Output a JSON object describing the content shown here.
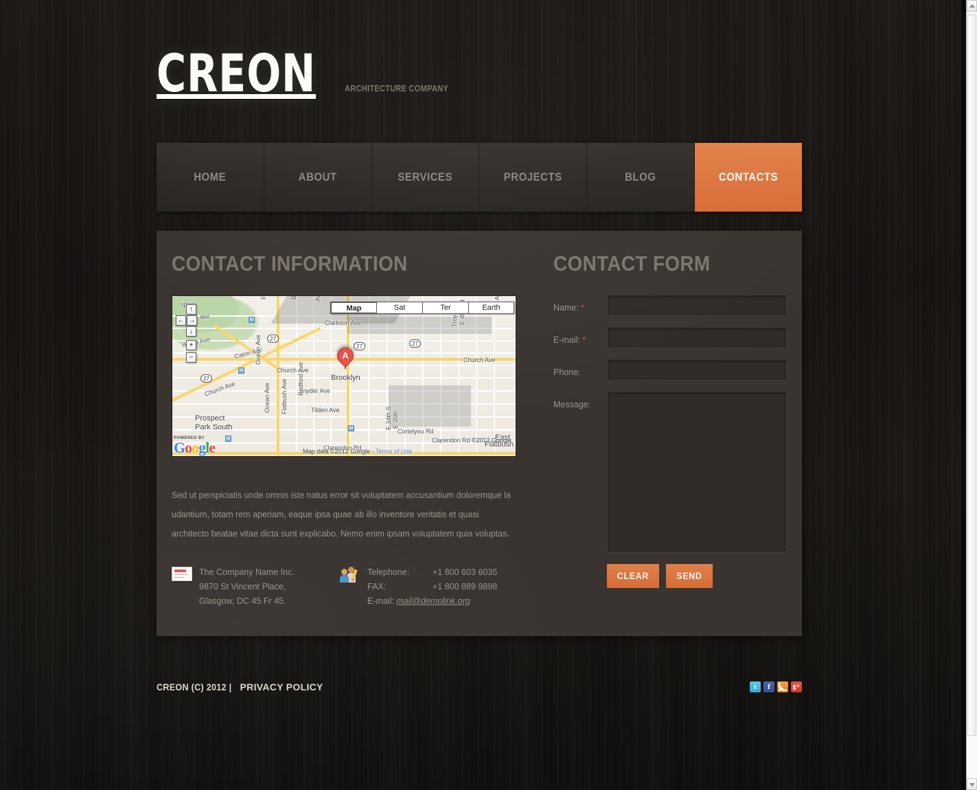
{
  "site": {
    "logo_name": "CREON",
    "logo_tagline": "Architecture Company"
  },
  "nav": {
    "items": [
      {
        "label": "Home",
        "active": false
      },
      {
        "label": "About",
        "active": false
      },
      {
        "label": "Services",
        "active": false
      },
      {
        "label": "Projects",
        "active": false
      },
      {
        "label": "Blog",
        "active": false
      },
      {
        "label": "Contacts",
        "active": true
      }
    ]
  },
  "contact_information": {
    "title": "Contact Information",
    "paragraph": "Sed ut perspiciatis unde omnis iste natus error sit voluptatem accusantium doloremque la udantium, totam rem aperiam, eaque ipsa quae ab illo inventore veritatis et quasi architecto beatae vitae dicta sunt explicabo. Nemo enim ipsam voluptatem quia voluptas.",
    "address": {
      "line1": "The Company Name Inc.",
      "line2": "9870 St Vincent Place,",
      "line3": "Glasgow, DC 45 Fr 45."
    },
    "phones": {
      "telephone_label": "Telephone:",
      "telephone_value": "+1 800 603 6035",
      "fax_label": "FAX:",
      "fax_value": "+1 800 889 9898",
      "email_label": "E-mail:",
      "email_value": "mail@demolink.org"
    }
  },
  "map": {
    "types": [
      {
        "label": "Map",
        "active": true
      },
      {
        "label": "Sat",
        "active": false
      },
      {
        "label": "Ter",
        "active": false
      },
      {
        "label": "Earth",
        "active": false
      }
    ],
    "controls": {
      "pan_up": "↑",
      "pan_left": "←",
      "pan_right": "→",
      "pan_down": "↓",
      "zoom_in": "+",
      "zoom_out": "−"
    },
    "marker_label": "A",
    "powered_by": "POWERED BY",
    "brand_letters": [
      "G",
      "o",
      "o",
      "g",
      "l",
      "e"
    ],
    "attribution": "Map data ©2012 Google - ",
    "terms_link": "Terms of Use",
    "copyright": "©2012 Google",
    "place_labels": [
      "Prospect Lake",
      "Parkside Ave",
      "Caton Ave",
      "Church Ave",
      "Church Ave",
      "Church Ave",
      "Snyder Ave",
      "Tilden Ave",
      "Cortelyou Rd",
      "Clarendon Rd",
      "Clarendon Rd",
      "Clarkson Ave",
      "Prospect Park South",
      "Brooklyn",
      "Flatbush Ave",
      "Bedford Ave",
      "Ocean Ave",
      "Ocean Ave",
      "Flatbush Ave",
      "Bedford Ave",
      "Troy Ave",
      "E 45th St",
      "E 35th St",
      "E 34th St",
      "Flatbush",
      "East",
      "Ave",
      "Ave"
    ],
    "highway_shields": [
      "27",
      "27",
      "27",
      "27"
    ]
  },
  "contact_form": {
    "title": "Contact Form",
    "fields": [
      {
        "label": "Name:",
        "required": true,
        "value": "",
        "placeholder": ""
      },
      {
        "label": "E-mail:",
        "required": true,
        "value": "",
        "placeholder": ""
      },
      {
        "label": "Phone:",
        "required": false,
        "value": "",
        "placeholder": ""
      },
      {
        "label": "Message:",
        "required": false,
        "value": "",
        "placeholder": ""
      }
    ],
    "clear_label": "Clear",
    "send_label": "Send"
  },
  "footer": {
    "copyright": "CREON (C) 2012 | ",
    "privacy_label": "Privacy Policy",
    "social": [
      {
        "name": "twitter",
        "glyph": "t"
      },
      {
        "name": "facebook",
        "glyph": "f"
      },
      {
        "name": "rss",
        "glyph": ""
      },
      {
        "name": "gplus",
        "glyph": "g+"
      }
    ]
  },
  "colors": {
    "accent": "#dd7540",
    "panel": "#393430",
    "text_muted": "#9b948b",
    "heading": "#7d766e"
  }
}
